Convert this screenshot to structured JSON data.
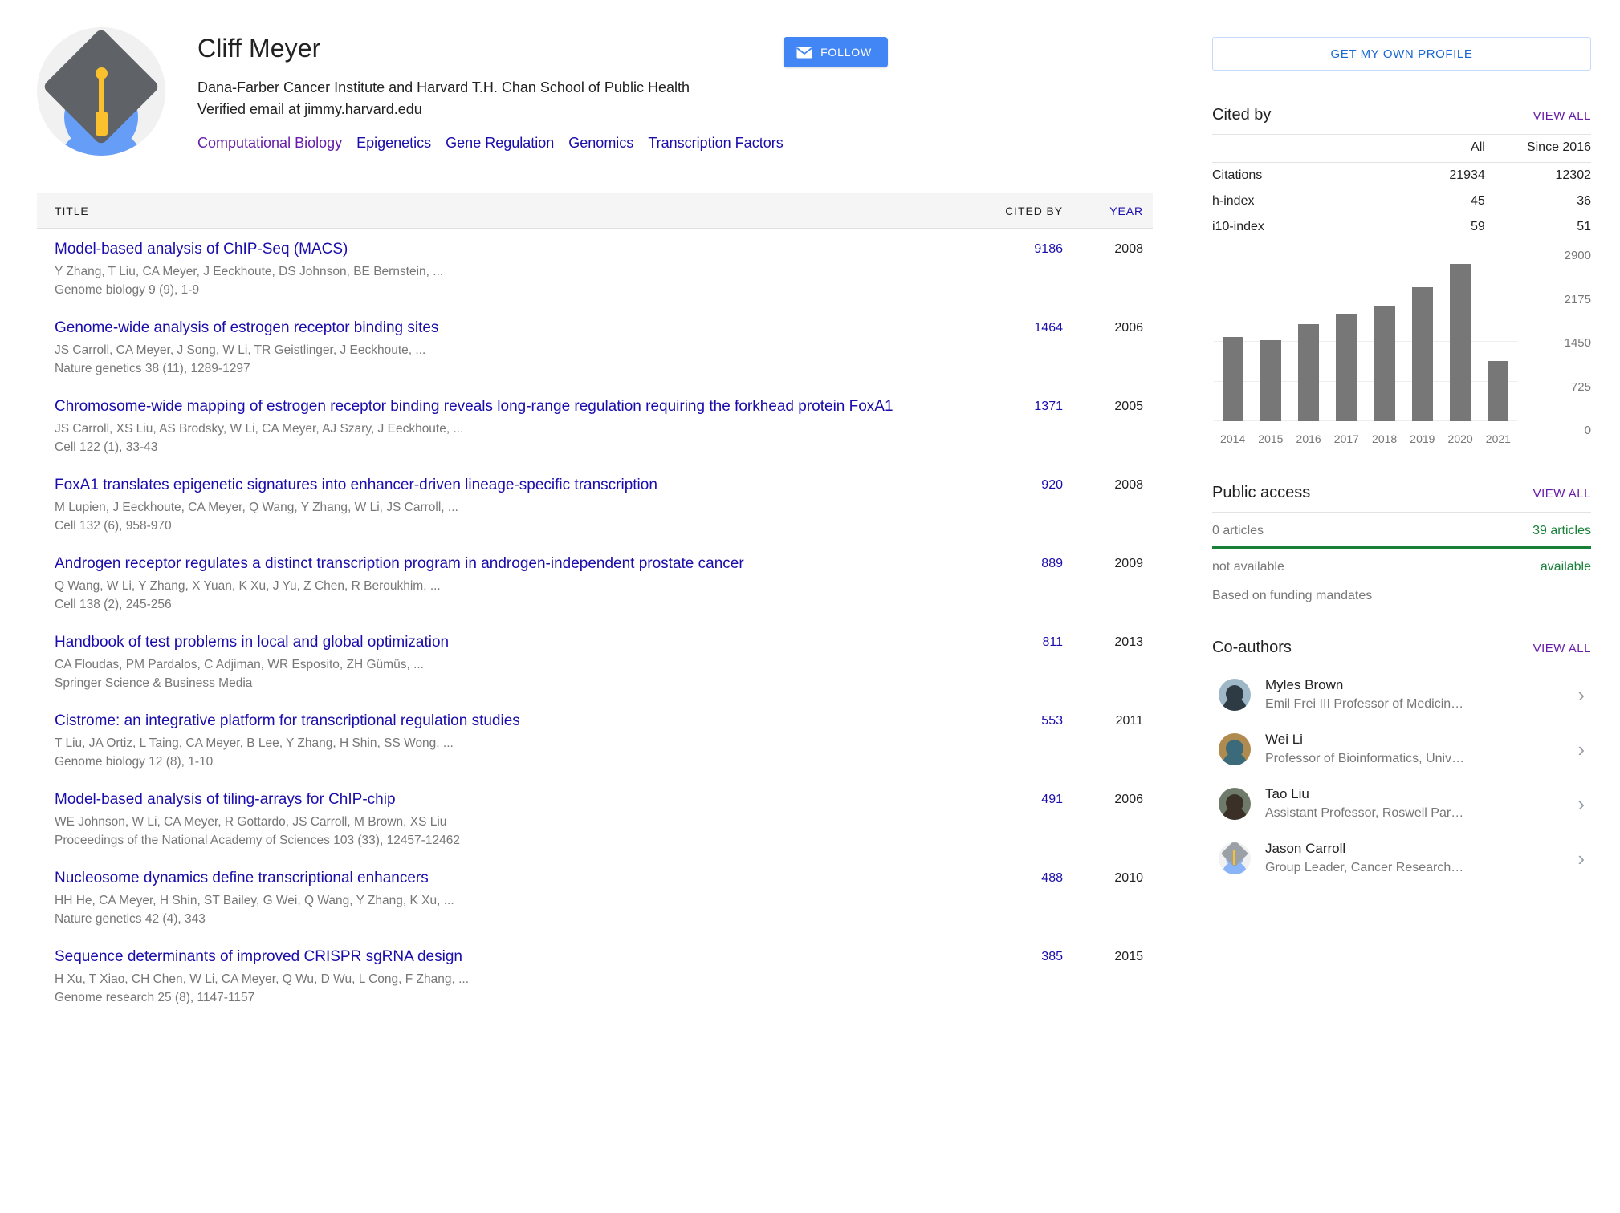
{
  "profile": {
    "name": "Cliff Meyer",
    "affiliation": "Dana-Farber Cancer Institute and Harvard T.H. Chan School of Public Health",
    "email_verified": "Verified email at jimmy.harvard.edu",
    "interests": [
      {
        "label": "Computational Biology",
        "visited": true
      },
      {
        "label": "Epigenetics",
        "visited": false
      },
      {
        "label": "Gene Regulation",
        "visited": false
      },
      {
        "label": "Genomics",
        "visited": false
      },
      {
        "label": "Transcription Factors",
        "visited": false
      }
    ],
    "follow_label": "FOLLOW",
    "avatar_icon": "graduation-cap-avatar"
  },
  "table": {
    "headers": {
      "title": "TITLE",
      "cited_by": "CITED BY",
      "year": "YEAR"
    },
    "rows": [
      {
        "title": "Model-based analysis of ChIP-Seq (MACS)",
        "authors": "Y Zhang, T Liu, CA Meyer, J Eeckhoute, DS Johnson, BE Bernstein, ...",
        "venue": "Genome biology 9 (9), 1-9",
        "cited_by": "9186",
        "year": "2008"
      },
      {
        "title": "Genome-wide analysis of estrogen receptor binding sites",
        "authors": "JS Carroll, CA Meyer, J Song, W Li, TR Geistlinger, J Eeckhoute, ...",
        "venue": "Nature genetics 38 (11), 1289-1297",
        "cited_by": "1464",
        "year": "2006"
      },
      {
        "title": "Chromosome-wide mapping of estrogen receptor binding reveals long-range regulation requiring the forkhead protein FoxA1",
        "authors": "JS Carroll, XS Liu, AS Brodsky, W Li, CA Meyer, AJ Szary, J Eeckhoute, ...",
        "venue": "Cell 122 (1), 33-43",
        "cited_by": "1371",
        "year": "2005"
      },
      {
        "title": "FoxA1 translates epigenetic signatures into enhancer-driven lineage-specific transcription",
        "authors": "M Lupien, J Eeckhoute, CA Meyer, Q Wang, Y Zhang, W Li, JS Carroll, ...",
        "venue": "Cell 132 (6), 958-970",
        "cited_by": "920",
        "year": "2008"
      },
      {
        "title": "Androgen receptor regulates a distinct transcription program in androgen-independent prostate cancer",
        "authors": "Q Wang, W Li, Y Zhang, X Yuan, K Xu, J Yu, Z Chen, R Beroukhim, ...",
        "venue": "Cell 138 (2), 245-256",
        "cited_by": "889",
        "year": "2009"
      },
      {
        "title": "Handbook of test problems in local and global optimization",
        "authors": "CA Floudas, PM Pardalos, C Adjiman, WR Esposito, ZH Gümüs, ...",
        "venue": "Springer Science & Business Media",
        "cited_by": "811",
        "year": "2013"
      },
      {
        "title": "Cistrome: an integrative platform for transcriptional regulation studies",
        "authors": "T Liu, JA Ortiz, L Taing, CA Meyer, B Lee, Y Zhang, H Shin, SS Wong, ...",
        "venue": "Genome biology 12 (8), 1-10",
        "cited_by": "553",
        "year": "2011"
      },
      {
        "title": "Model-based analysis of tiling-arrays for ChIP-chip",
        "authors": "WE Johnson, W Li, CA Meyer, R Gottardo, JS Carroll, M Brown, XS Liu",
        "venue": "Proceedings of the National Academy of Sciences 103 (33), 12457-12462",
        "cited_by": "491",
        "year": "2006"
      },
      {
        "title": "Nucleosome dynamics define transcriptional enhancers",
        "authors": "HH He, CA Meyer, H Shin, ST Bailey, G Wei, Q Wang, Y Zhang, K Xu, ...",
        "venue": "Nature genetics 42 (4), 343",
        "cited_by": "488",
        "year": "2010"
      },
      {
        "title": "Sequence determinants of improved CRISPR sgRNA design",
        "authors": "H Xu, T Xiao, CH Chen, W Li, CA Meyer, Q Wu, D Wu, L Cong, F Zhang, ...",
        "venue": "Genome research 25 (8), 1147-1157",
        "cited_by": "385",
        "year": "2015"
      }
    ]
  },
  "sidebar": {
    "get_own_profile": "GET MY OWN PROFILE",
    "cited_by": {
      "title": "Cited by",
      "view_all": "VIEW ALL",
      "col_all": "All",
      "col_since": "Since 2016",
      "rows": [
        {
          "label": "Citations",
          "all": "21934",
          "since": "12302"
        },
        {
          "label": "h-index",
          "all": "45",
          "since": "36"
        },
        {
          "label": "i10-index",
          "all": "59",
          "since": "51"
        }
      ]
    },
    "public_access": {
      "title": "Public access",
      "view_all": "VIEW ALL",
      "not_available_count": "0 articles",
      "available_count": "39 articles",
      "not_available_label": "not available",
      "available_label": "available",
      "note": "Based on funding mandates",
      "bar_color": "#188038"
    },
    "coauthors": {
      "title": "Co-authors",
      "view_all": "VIEW ALL",
      "items": [
        {
          "name": "Myles Brown",
          "affiliation": "Emil Frei III Professor of Medicin…",
          "avatar": "photo"
        },
        {
          "name": "Wei Li",
          "affiliation": "Professor of Bioinformatics, Univ…",
          "avatar": "photo"
        },
        {
          "name": "Tao Liu",
          "affiliation": "Assistant Professor, Roswell Par…",
          "avatar": "photo"
        },
        {
          "name": "Jason Carroll",
          "affiliation": "Group Leader, Cancer Research…",
          "avatar": "placeholder"
        }
      ],
      "arrow_icon": "chevron-right-icon"
    }
  },
  "chart_data": {
    "type": "bar",
    "title": "Citations per year",
    "categories": [
      "2014",
      "2015",
      "2016",
      "2017",
      "2018",
      "2019",
      "2020",
      "2021"
    ],
    "values": [
      1540,
      1480,
      1770,
      1950,
      2100,
      2450,
      2870,
      1100
    ],
    "ylim": [
      0,
      2900
    ],
    "yticks": [
      0,
      725,
      1450,
      2175,
      2900
    ],
    "ytick_labels": [
      "0",
      "725",
      "1450",
      "2175",
      "2900"
    ],
    "xlabel": "",
    "ylabel": "",
    "grid": true,
    "bar_color": "#777777",
    "legend": false
  }
}
